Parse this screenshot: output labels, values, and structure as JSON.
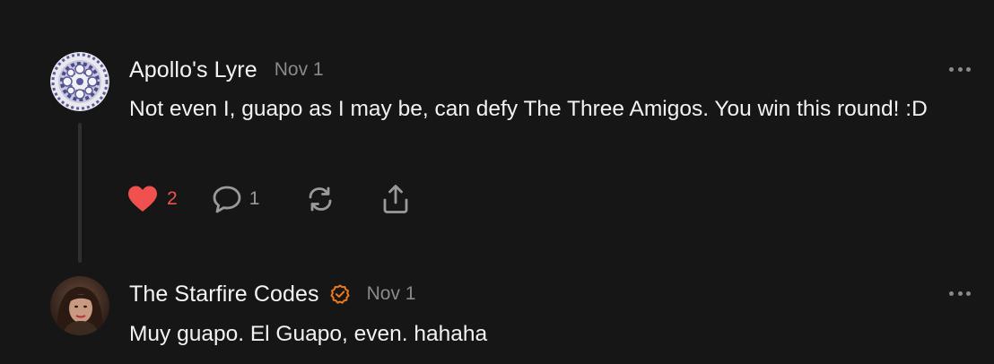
{
  "comments": [
    {
      "author": "Apollo's Lyre",
      "date": "Nov 1",
      "text": "Not even I, guapo as I may be, can defy The Three Amigos. You win this round! :D",
      "likes": "2",
      "replies": "1",
      "liked": true,
      "avatar": "pattern-avatar"
    },
    {
      "author": "The Starfire Codes",
      "date": "Nov 1",
      "text": "Muy guapo. El Guapo, even. hahaha",
      "verified": true,
      "avatar": "photo-avatar"
    }
  ],
  "icons": {
    "like": "heart-icon",
    "reply": "speech-bubble-icon",
    "restack": "restack-icon",
    "share": "share-icon",
    "more": "more-options-icon",
    "verified": "verified-badge-icon"
  },
  "colors": {
    "background": "#161616",
    "like_active": "#f0514e",
    "verified": "#f07a1a",
    "muted": "#8a8a8a",
    "text": "#f2f2f2"
  }
}
